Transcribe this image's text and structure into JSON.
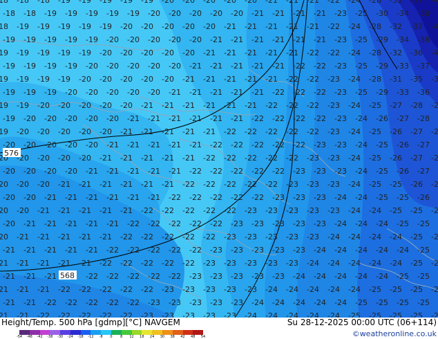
{
  "title": {
    "left": "Height/Temp. 500 hPa [gdmp][°C] NAVGEM",
    "right": "Su 28-12-2025 00:00 UTC (06+114)"
  },
  "credit": "©weatheronline.co.uk",
  "contour_labels": [
    "576",
    "568"
  ],
  "colorbar": {
    "labels": [
      "-54",
      "-48",
      "-42",
      "-38",
      "-30",
      "-24",
      "-18",
      "-12",
      "-8",
      "0",
      "8",
      "12",
      "18",
      "24",
      "30",
      "38",
      "42",
      "48",
      "54"
    ],
    "colors": [
      "#5a2a7a",
      "#8e2fa8",
      "#c23fd0",
      "#9a60e8",
      "#5a3fe0",
      "#2a2ad0",
      "#1a5ff0",
      "#1a9ff0",
      "#26c6f5",
      "#1ab05a",
      "#46c83a",
      "#98d82a",
      "#e6e632",
      "#f0c020",
      "#f09018",
      "#e06018",
      "#d03018",
      "#b01818"
    ]
  },
  "colors": {
    "band_m18": "#46c8f7",
    "band_m19": "#33b6f2",
    "band_m20": "#28a5ee",
    "band_m21": "#2196ea",
    "band_m22": "#1f86e6",
    "band_m24": "#1d6ee0",
    "band_m26": "#1e55d6",
    "band_m30": "#1a3bc8",
    "band_m34": "#1622b0",
    "band_m36": "#10139a",
    "coast": "#8aa7bd",
    "contour": "#000000"
  }
}
